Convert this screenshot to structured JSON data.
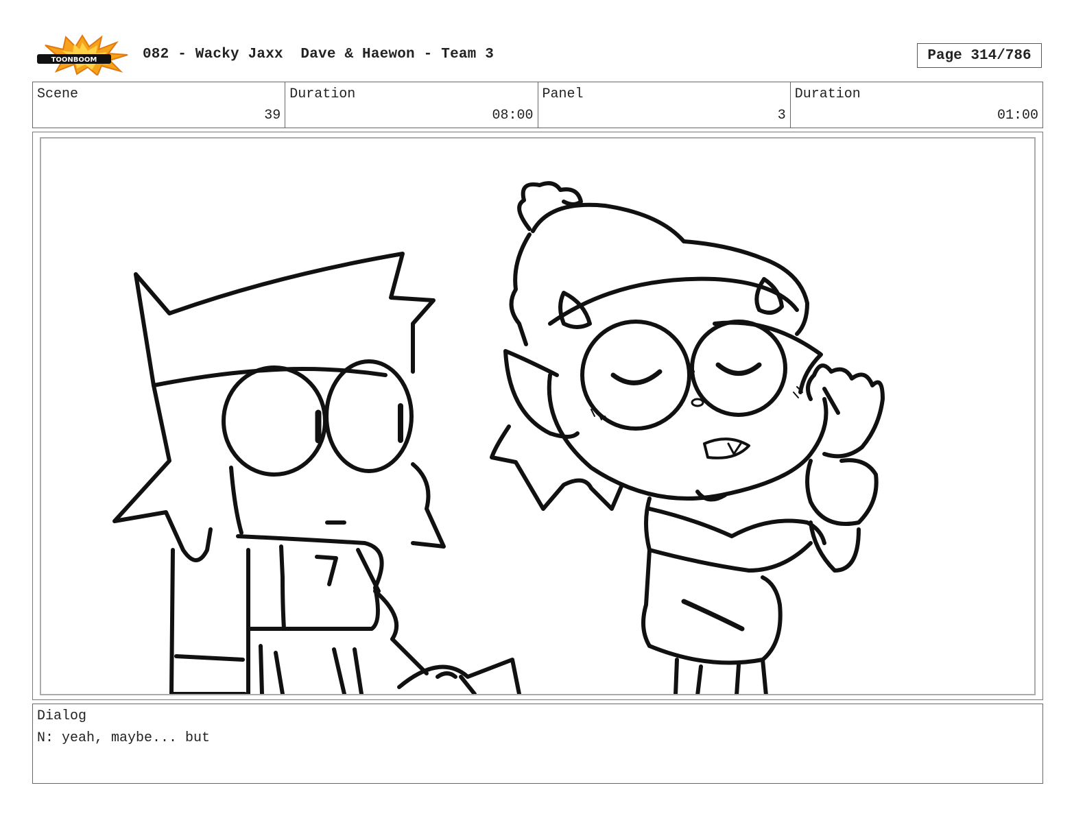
{
  "header": {
    "logo_text": "TOONBOOM",
    "title": "082 - Wacky Jaxx  Dave & Haewon - Team 3",
    "page": "Page 314/786"
  },
  "info": {
    "scene_label": "Scene",
    "scene_value": "39",
    "scene_duration_label": "Duration",
    "scene_duration_value": "08:00",
    "panel_label": "Panel",
    "panel_value": "3",
    "panel_duration_label": "Duration",
    "panel_duration_value": "01:00"
  },
  "panel": {
    "drawing": "storyboard-sketch-two-characters"
  },
  "dialog": {
    "label": "Dialog",
    "text": "N: yeah, maybe... but"
  }
}
